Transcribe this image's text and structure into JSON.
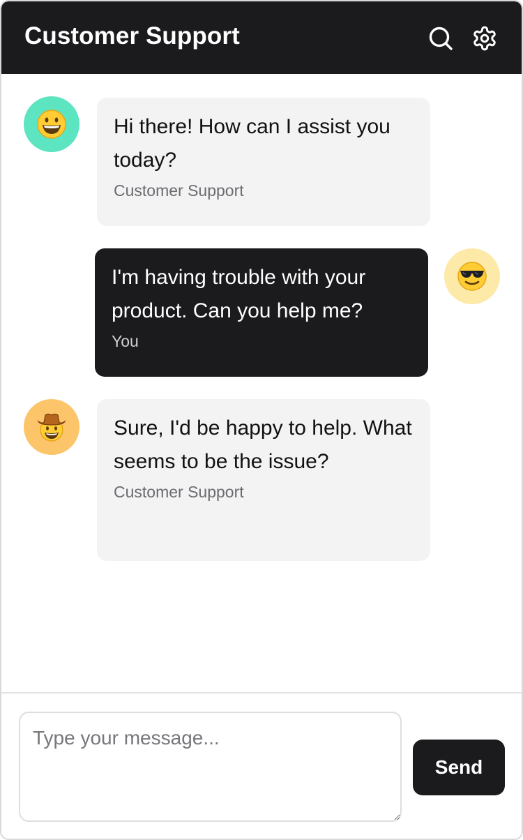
{
  "header": {
    "title": "Customer Support",
    "icons": [
      "search-icon",
      "gear-icon"
    ]
  },
  "colors": {
    "header_bg": "#1b1b1d",
    "agent_bubble": "#f3f3f4",
    "user_bubble": "#1b1b1d",
    "avatar_agent_1": "#5de4c1",
    "avatar_user": "#fde9a8",
    "avatar_agent_2": "#fcc56a"
  },
  "messages": [
    {
      "role": "agent",
      "avatar_icon": "grinning-face-emoji",
      "text": "Hi there! How can I assist you today?",
      "sender": "Customer Support"
    },
    {
      "role": "user",
      "avatar_icon": "sunglasses-face-emoji",
      "text": "I'm having trouble with your product. Can you help me?",
      "sender": "You"
    },
    {
      "role": "agent",
      "avatar_icon": "cowboy-face-emoji",
      "text": "Sure, I'd be happy to help. What seems to be the issue?",
      "sender": "Customer Support"
    }
  ],
  "composer": {
    "placeholder": "Type your message...",
    "value": "",
    "send_label": "Send"
  }
}
